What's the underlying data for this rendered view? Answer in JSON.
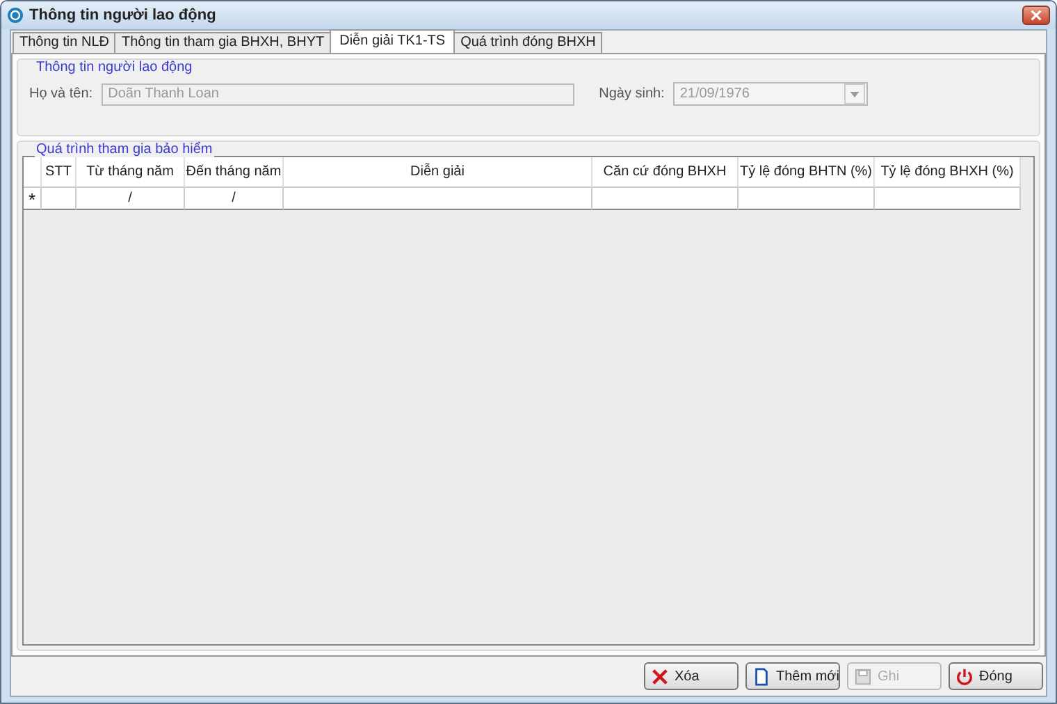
{
  "window": {
    "title": "Thông tin người lao động"
  },
  "tabs": [
    {
      "label": "Thông tin NLĐ",
      "selected": false
    },
    {
      "label": "Thông tin tham gia BHXH, BHYT",
      "selected": false
    },
    {
      "label": "Diễn giải TK1-TS",
      "selected": true
    },
    {
      "label": "Quá trình đóng BHXH",
      "selected": false
    }
  ],
  "employee": {
    "title": "Thông tin người lao động",
    "name_label": "Họ và tên:",
    "name_value": "Doãn Thanh Loan",
    "name_disabled": true,
    "birth_label": "Ngày sinh:",
    "birth_value": "21/09/1976",
    "birth_disabled": true
  },
  "history": {
    "title": "Quá trình tham gia bảo hiểm",
    "columns": [
      "STT",
      "Từ tháng năm",
      "Đến tháng năm",
      "Diễn giải",
      "Căn cứ đóng BHXH",
      "Tỷ lệ đóng BHTN (%)",
      "Tỷ lệ đóng BHXH (%)"
    ],
    "new_row": {
      "marker": "*",
      "cells": [
        "",
        "/",
        "/",
        "",
        "",
        "",
        ""
      ]
    }
  },
  "buttons": [
    {
      "label": "Xóa",
      "kind": "delete",
      "disabled": false
    },
    {
      "label": "Thêm mới",
      "kind": "new",
      "disabled": false
    },
    {
      "label": "Ghi",
      "kind": "save",
      "disabled": true
    },
    {
      "label": "Đóng",
      "kind": "close",
      "disabled": false
    }
  ]
}
